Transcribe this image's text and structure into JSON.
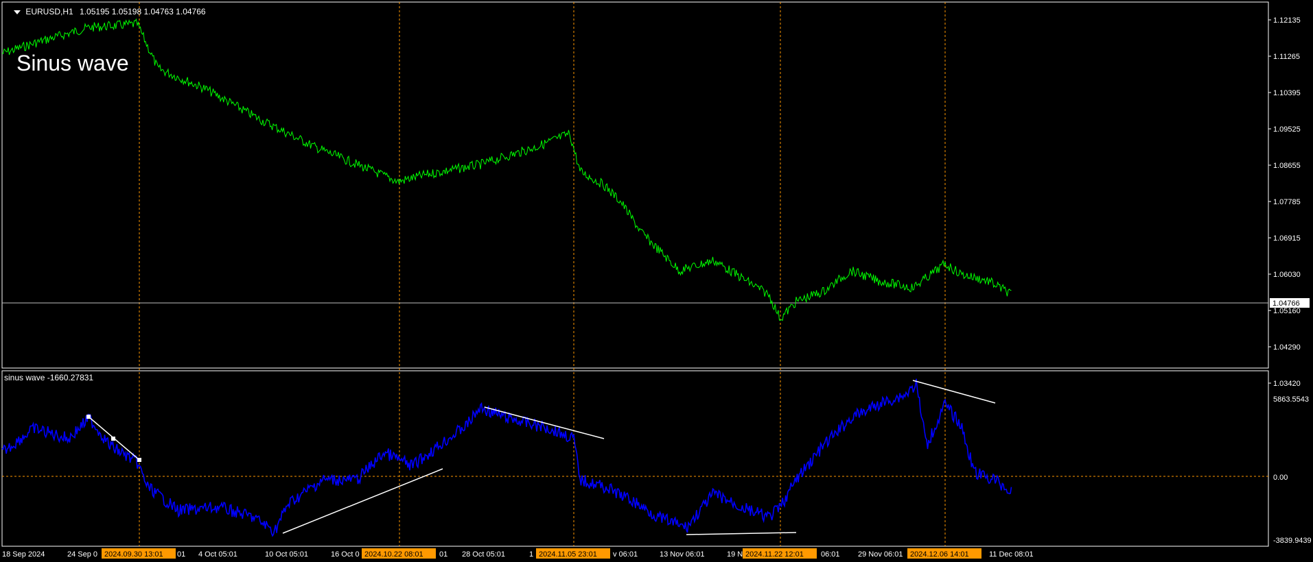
{
  "main_chart": {
    "symbol": "EURUSD,H1",
    "ohlc": "1.05195 1.05198 1.04763 1.04766",
    "overlay_text": "Sinus wave",
    "price_ticks": [
      "1.12135",
      "1.11265",
      "1.10395",
      "1.09525",
      "1.08655",
      "1.07785",
      "1.06915",
      "1.06030",
      "1.05160",
      "1.04290",
      "1.03420"
    ],
    "current_price": "1.04766",
    "line_color": "#00ff00"
  },
  "indicator": {
    "title": "sinus wave -1660.27831",
    "ticks": [
      "5863.5543",
      "0.00",
      "-3839.9439"
    ],
    "line_color": "#0000ff"
  },
  "time_axis": {
    "labels": [
      "18 Sep 2024",
      "24 Sep 0",
      "4 Oct 05:01",
      "10 Oct 05:01",
      "16 Oct 0",
      "28 Oct 05:01",
      "1",
      "v 06:01",
      "13 Nov 06:01",
      "19 N",
      "06:01",
      "29 Nov 06:01",
      "11 Dec 08:01"
    ],
    "highlighted": [
      "2024.09.30 13:01",
      "2024.10.22 08:01",
      "2024.11.05 23:01",
      "2024.11.22 12:01",
      "2024.12.06 14:01"
    ],
    "highlight_suffix": [
      "01",
      "01"
    ]
  },
  "colors": {
    "background": "#000000",
    "grid_vline": "#ff9900",
    "trendline": "#ffffff",
    "axis_highlight": "#ff9900"
  }
}
